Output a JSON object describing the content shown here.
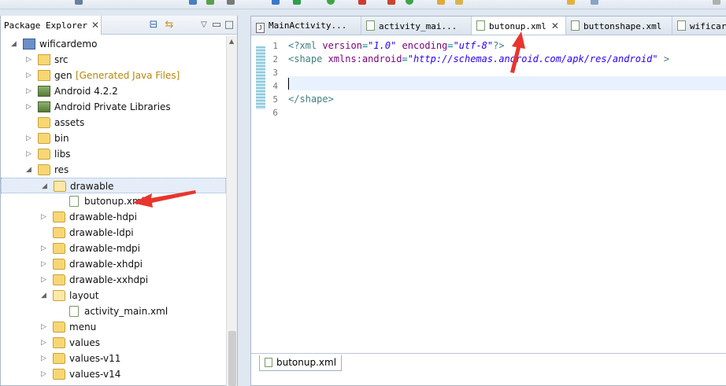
{
  "package_explorer": {
    "tab_title": "Package Explorer",
    "tab_close": "✕",
    "view_buttons": [
      "collapse-all-icon",
      "link-with-editor-icon",
      "view-menu-icon",
      "minimize-icon",
      "maximize-icon"
    ],
    "tree": [
      {
        "label": "wificardemo",
        "decoration": "",
        "level": 0,
        "expanded": true,
        "icon": "project-icon"
      },
      {
        "label": "src",
        "decoration": "",
        "level": 1,
        "expanded": false,
        "icon": "source-folder-icon"
      },
      {
        "label": "gen",
        "decoration": "[Generated Java Files]",
        "level": 1,
        "expanded": false,
        "icon": "source-folder-icon"
      },
      {
        "label": "Android 4.2.2",
        "decoration": "",
        "level": 1,
        "expanded": false,
        "icon": "library-icon"
      },
      {
        "label": "Android Private Libraries",
        "decoration": "",
        "level": 1,
        "expanded": false,
        "icon": "library-icon"
      },
      {
        "label": "assets",
        "decoration": "",
        "level": 1,
        "expanded": null,
        "icon": "folder-icon"
      },
      {
        "label": "bin",
        "decoration": "",
        "level": 1,
        "expanded": false,
        "icon": "folder-icon"
      },
      {
        "label": "libs",
        "decoration": "",
        "level": 1,
        "expanded": false,
        "icon": "folder-icon"
      },
      {
        "label": "res",
        "decoration": "",
        "level": 1,
        "expanded": true,
        "icon": "folder-icon"
      },
      {
        "label": "drawable",
        "decoration": "",
        "level": 2,
        "expanded": true,
        "icon": "open-folder-icon",
        "selected": true
      },
      {
        "label": "butonup.xml",
        "decoration": "",
        "level": 3,
        "expanded": null,
        "icon": "xml-file-icon"
      },
      {
        "label": "drawable-hdpi",
        "decoration": "",
        "level": 2,
        "expanded": false,
        "icon": "folder-icon"
      },
      {
        "label": "drawable-ldpi",
        "decoration": "",
        "level": 2,
        "expanded": null,
        "icon": "folder-icon"
      },
      {
        "label": "drawable-mdpi",
        "decoration": "",
        "level": 2,
        "expanded": false,
        "icon": "folder-icon"
      },
      {
        "label": "drawable-xhdpi",
        "decoration": "",
        "level": 2,
        "expanded": false,
        "icon": "folder-icon"
      },
      {
        "label": "drawable-xxhdpi",
        "decoration": "",
        "level": 2,
        "expanded": false,
        "icon": "folder-icon"
      },
      {
        "label": "layout",
        "decoration": "",
        "level": 2,
        "expanded": true,
        "icon": "open-folder-icon"
      },
      {
        "label": "activity_main.xml",
        "decoration": "",
        "level": 3,
        "expanded": null,
        "icon": "xml-file-icon"
      },
      {
        "label": "menu",
        "decoration": "",
        "level": 2,
        "expanded": false,
        "icon": "folder-icon"
      },
      {
        "label": "values",
        "decoration": "",
        "level": 2,
        "expanded": false,
        "icon": "folder-icon"
      },
      {
        "label": "values-v11",
        "decoration": "",
        "level": 2,
        "expanded": false,
        "icon": "folder-icon"
      },
      {
        "label": "values-v14",
        "decoration": "",
        "level": 2,
        "expanded": false,
        "icon": "folder-icon"
      }
    ]
  },
  "editor": {
    "tabs": [
      {
        "label": "MainActivity...",
        "icon": "java-file-icon",
        "active": false
      },
      {
        "label": "activity_mai...",
        "icon": "xml-file-icon",
        "active": false
      },
      {
        "label": "butonup.xml",
        "icon": "xml-file-icon",
        "active": true,
        "close": "✕"
      },
      {
        "label": "buttonshape.xml",
        "icon": "xml-file-icon",
        "active": false
      },
      {
        "label": "wificard",
        "icon": "xml-file-icon",
        "active": false
      }
    ],
    "line_numbers": [
      "1",
      "2",
      "3",
      "4",
      "5",
      "6"
    ],
    "lines": [
      [
        {
          "t": "<?xml ",
          "c": "tag"
        },
        {
          "t": "version",
          "c": "attr"
        },
        {
          "t": "=",
          "c": "punct"
        },
        {
          "t": "\"1.0\"",
          "c": "val"
        },
        {
          "t": " ",
          "c": ""
        },
        {
          "t": "encoding",
          "c": "attr"
        },
        {
          "t": "=",
          "c": "punct"
        },
        {
          "t": "\"utf-8\"",
          "c": "val"
        },
        {
          "t": "?>",
          "c": "tag"
        }
      ],
      [
        {
          "t": "<shape ",
          "c": "tag"
        },
        {
          "t": "xmlns:android",
          "c": "attr"
        },
        {
          "t": "=",
          "c": "punct"
        },
        {
          "t": "\"http://schemas.android.com/apk/res/android\"",
          "c": "val"
        },
        {
          "t": " >",
          "c": "tag"
        }
      ],
      [],
      [],
      [
        {
          "t": "</shape>",
          "c": "tag"
        }
      ],
      []
    ],
    "bottom_tab": "butonup.xml"
  },
  "accent_color": "#e8352e"
}
